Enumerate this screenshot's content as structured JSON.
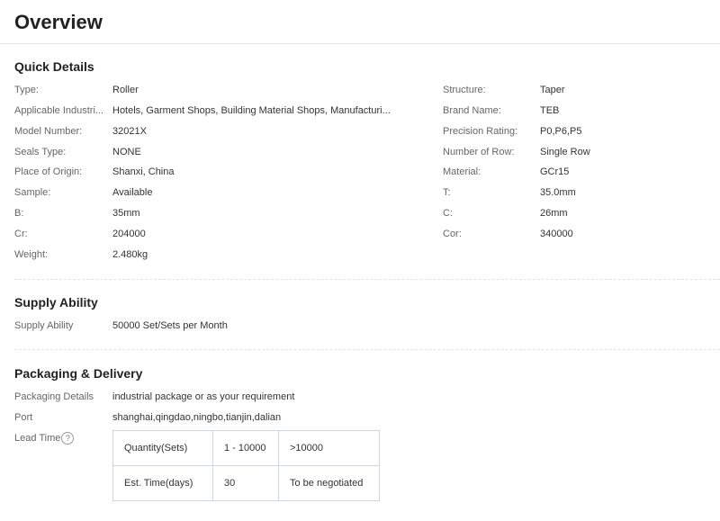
{
  "title": "Overview",
  "quick_details": {
    "heading": "Quick Details",
    "left": [
      {
        "label": "Type:",
        "value": "Roller"
      },
      {
        "label": "Applicable Industri...",
        "value": "Hotels, Garment Shops, Building Material Shops, Manufacturi..."
      },
      {
        "label": "Model Number:",
        "value": "32021X"
      },
      {
        "label": "Seals Type:",
        "value": "NONE"
      },
      {
        "label": "Place of Origin:",
        "value": "Shanxi, China"
      },
      {
        "label": "Sample:",
        "value": "Available"
      },
      {
        "label": "B:",
        "value": "35mm"
      },
      {
        "label": "Cr:",
        "value": "204000"
      },
      {
        "label": "Weight:",
        "value": "2.480kg"
      }
    ],
    "right": [
      {
        "label": "Structure:",
        "value": "Taper"
      },
      {
        "label": "Brand Name:",
        "value": "TEB"
      },
      {
        "label": "Precision Rating:",
        "value": "P0,P6,P5"
      },
      {
        "label": "Number of Row:",
        "value": "Single Row"
      },
      {
        "label": "Material:",
        "value": "GCr15"
      },
      {
        "label": "T:",
        "value": "35.0mm"
      },
      {
        "label": "C:",
        "value": "26mm"
      },
      {
        "label": "Cor:",
        "value": "340000"
      }
    ]
  },
  "supply_ability": {
    "heading": "Supply Ability",
    "label": "Supply Ability",
    "value": "50000 Set/Sets per Month"
  },
  "packaging": {
    "heading": "Packaging & Delivery",
    "details_label": "Packaging Details",
    "details_value": "industrial package or as your requirement",
    "port_label": "Port",
    "port_value": "shanghai,qingdao,ningbo,tianjin,dalian",
    "lead_time_label": "Lead Time",
    "help_glyph": "?",
    "lead_table": {
      "row1": [
        "Quantity(Sets)",
        "1 - 10000",
        ">10000"
      ],
      "row2": [
        "Est. Time(days)",
        "30",
        "To be negotiated"
      ]
    }
  }
}
